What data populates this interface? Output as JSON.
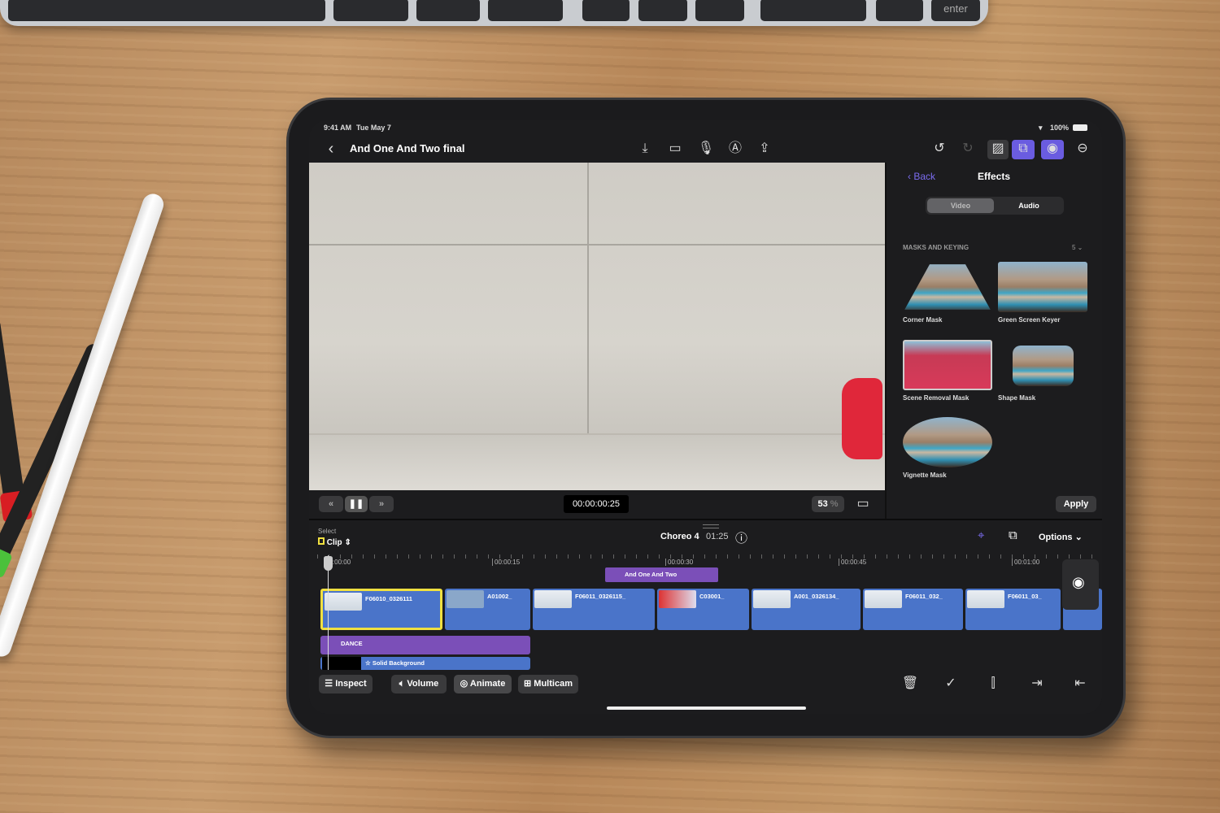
{
  "keyboard": {
    "enter_key": "enter"
  },
  "status_bar": {
    "time": "9:41 AM",
    "date": "Tue May 7",
    "battery": "100%"
  },
  "toolbar": {
    "project_title": "And One And Two final",
    "icons": [
      "import-icon",
      "camera-icon",
      "microphone-icon",
      "voiceover-icon",
      "share-icon",
      "undo-icon",
      "redo-icon",
      "photos-icon",
      "effects-browser-icon",
      "inspector-icon",
      "more-icon"
    ]
  },
  "effects": {
    "back": "Back",
    "title": "Effects",
    "tabs": [
      "Video",
      "Audio"
    ],
    "selected_tab": "Video",
    "section": "MASKS AND KEYING",
    "count": "5",
    "items": [
      "Corner Mask",
      "Green Screen Keyer",
      "Scene Removal Mask",
      "Shape Mask",
      "Vignette Mask"
    ],
    "selected_item": "Scene Removal Mask",
    "apply": "Apply"
  },
  "transport": {
    "timecode": "00:00:00:25",
    "zoom": "53",
    "zoom_unit": "%"
  },
  "timeline": {
    "select_label": "Select",
    "select_mode": "Clip",
    "project": "Choreo 4",
    "duration": "01:25",
    "options": "Options",
    "ruler": [
      "00:00:00",
      "00:00:15",
      "00:00:30",
      "00:00:45",
      "00:01:00"
    ],
    "title_clip": "And One And Two",
    "clips": [
      "F06010_0326111",
      "A01002_",
      "F06011_0326115_",
      "C03001_",
      "A001_0326134_",
      "F06011_032_",
      "F06011_03_"
    ],
    "dance_clip": "DANCE",
    "background_clip": "Solid Background",
    "colors": {
      "primary": "#4a74c9",
      "connected": "#7b4fb8",
      "selection": "#f0e040"
    }
  },
  "bottom_bar": {
    "inspect": "Inspect",
    "volume": "Volume",
    "animate": "Animate",
    "multicam": "Multicam"
  }
}
